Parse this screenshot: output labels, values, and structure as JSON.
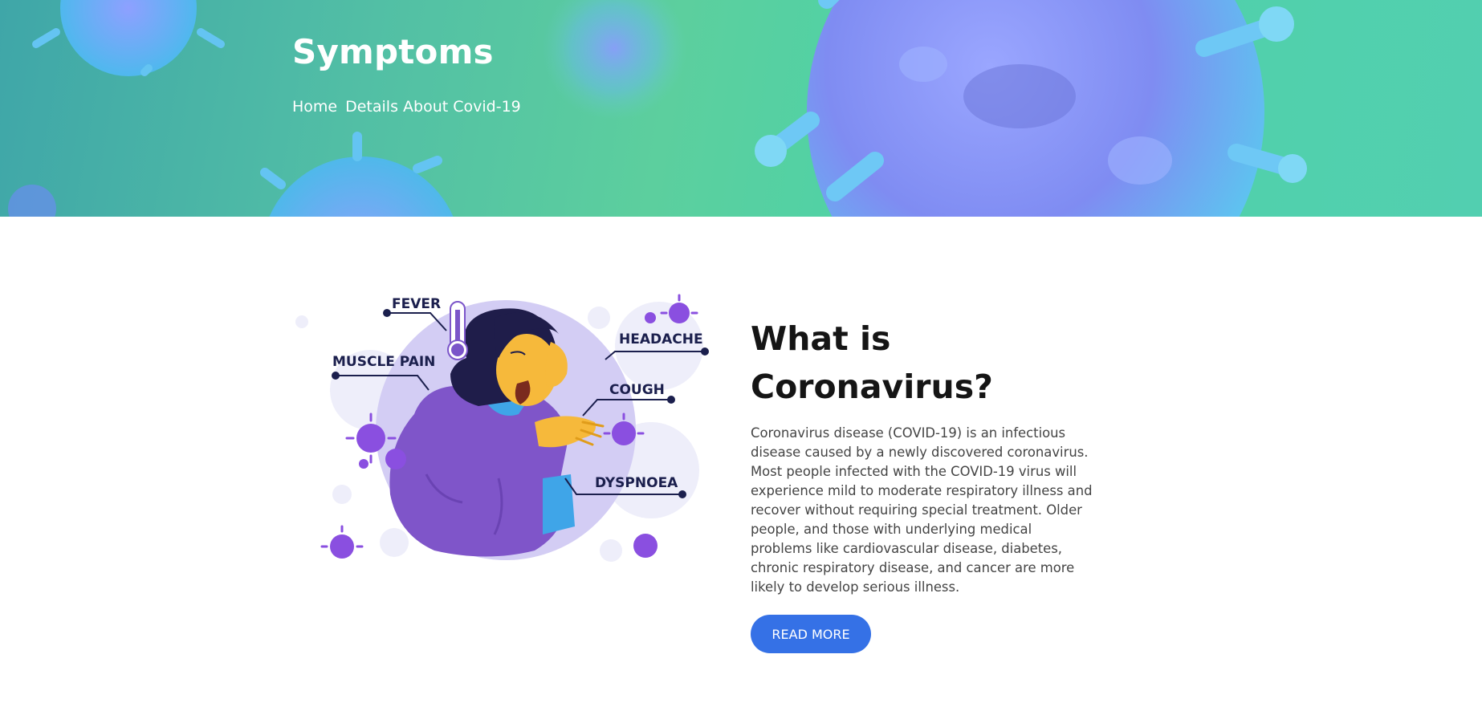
{
  "hero": {
    "title": "Symptoms",
    "breadcrumb": {
      "home": "Home",
      "current": "Details About Covid-19"
    }
  },
  "illustration": {
    "labels": {
      "fever": "FEVER",
      "headache": "HEADACHE",
      "muscle_pain": "MUSCLE PAIN",
      "cough": "COUGH",
      "dyspnoea": "DYSPNOEA"
    }
  },
  "about": {
    "title_line1": "What is",
    "title_line2": "Coronavirus?",
    "body": "Coronavirus disease (COVID-19) is an infectious disease caused by a newly discovered coronavirus. Most people infected with the COVID-19 virus will experience mild to moderate respiratory illness and recover without requiring special treatment. Older people, and those with underlying medical problems like cardiovascular disease, diabetes, chronic respiratory disease, and cancer are more likely to develop serious illness.",
    "button": "READ MORE"
  },
  "colors": {
    "accent": "#3571e6",
    "virus": "#7b6cf0",
    "illustration_purple": "#7e57c8",
    "label": "#1b1f4d"
  }
}
